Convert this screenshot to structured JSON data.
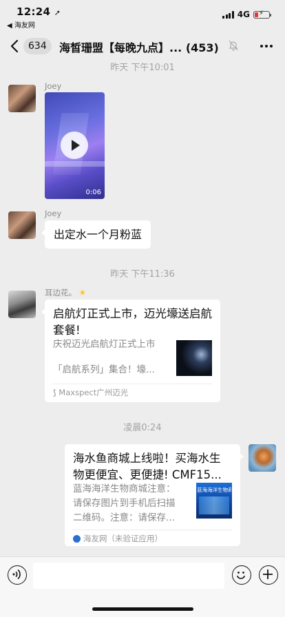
{
  "status_bar": {
    "time": "12:24",
    "back_app": "◀ 海友网",
    "network": "4G"
  },
  "nav": {
    "unread_count": "634",
    "title": "海皙珊盟【每晚九点】...",
    "member_count": "(453)"
  },
  "messages": [
    {
      "type": "timestamp",
      "text": "昨天 下午10:01"
    },
    {
      "type": "video",
      "sender": "Joey",
      "duration": "0:06"
    },
    {
      "type": "text",
      "sender": "Joey",
      "text": "出定水一个月粉蓝"
    },
    {
      "type": "timestamp",
      "text": "昨天 下午11:36"
    },
    {
      "type": "link_card",
      "sender": "耳边花。",
      "title": "启航灯正式上市，迈光壕送启航套餐!",
      "desc_line1": "庆祝迈光启航灯正式上市",
      "desc_line2": "「启航系列」集合！壕...",
      "source": "Maxspect广州迈光"
    },
    {
      "type": "timestamp",
      "text": "凌晨0:24"
    },
    {
      "type": "link_card",
      "sender": "self",
      "title_line1": "海水鱼商城上线啦！买海水生",
      "title_line2": "物更便宜、更便捷! CMF15...",
      "desc_line1": "蓝海海洋生物商城注意：",
      "desc_line2": "请保存图片到手机后扫描",
      "desc_line3": "二维码。注意：请保存...",
      "thumb_text": "蓝海海洋生物商城",
      "source": "海友网（未验证应用）"
    }
  ]
}
